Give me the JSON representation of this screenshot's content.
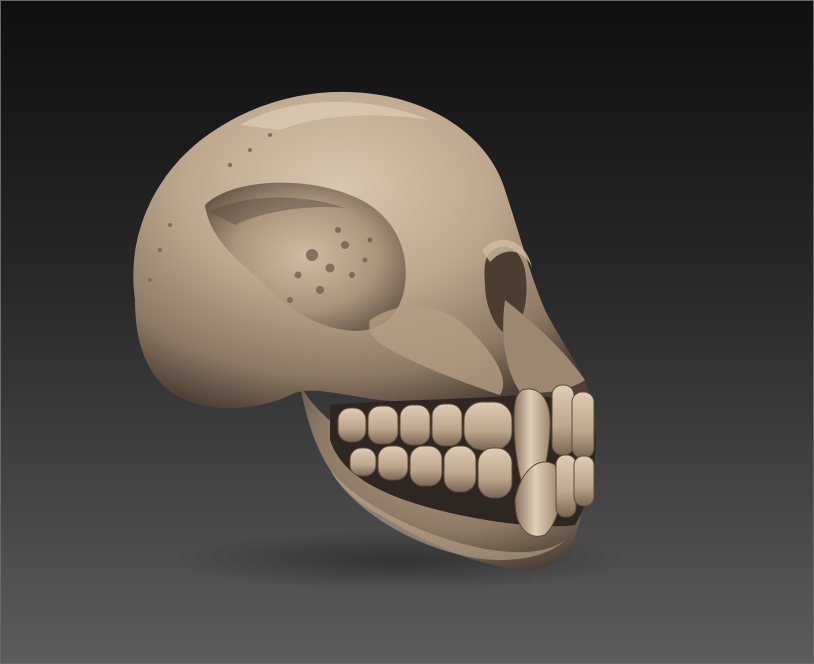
{
  "scene": {
    "background_top": "#0f0f0f",
    "background_bottom": "#5c5c5c",
    "material_light": "#c9b49c",
    "material_mid": "#a8947c",
    "material_dark": "#5a4a3c",
    "material_shadow": "#2e2620",
    "frame_edge": "#6a6a6a",
    "subject_icon": "skull-sculpt-icon"
  }
}
